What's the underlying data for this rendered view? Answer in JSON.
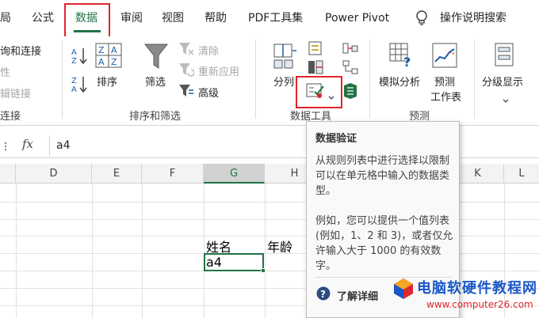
{
  "tabs": [
    "局",
    "公式",
    "数据",
    "审阅",
    "视图",
    "帮助",
    "PDF工具集",
    "Power Pivot",
    "操作说明搜索"
  ],
  "active_tab": "数据",
  "ribbon": {
    "query": {
      "item1": "询和连接",
      "item2": "性",
      "item3": "辑链接",
      "label": "连接"
    },
    "sort": {
      "sort_label": "排序",
      "filter_label": "筛选",
      "clear": "清除",
      "reapply": "重新应用",
      "advanced": "高级",
      "group_label": "排序和筛选"
    },
    "tools": {
      "split_label": "分列",
      "group_label": "数据工具"
    },
    "forecast": {
      "whatif": "模拟分析",
      "forecast_sheet_line1": "预测",
      "forecast_sheet_line2": "工作表",
      "group_label": "预测"
    },
    "outline": {
      "label": "分级显示"
    }
  },
  "formula_bar": {
    "fx": "fx",
    "value": "a4"
  },
  "columns": [
    "D",
    "E",
    "F",
    "G",
    "H",
    "K",
    "L"
  ],
  "cells": {
    "g_header": "姓名",
    "h_header": "年龄",
    "g_value": "a4"
  },
  "tooltip": {
    "title": "数据验证",
    "para1": "从规则列表中进行选择以限制可以在单元格中输入的数据类型。",
    "para2": "例如，您可以提供一个值列表(例如，1、2 和 3)，或者仅允许输入大于 1000 的有效数字。",
    "help": "了解详细"
  },
  "watermark": {
    "line1": "电脑软硬件教程网",
    "line2": "www.computer26.com"
  },
  "colors": {
    "accent": "#217346",
    "highlight": "#e0252c",
    "watermark_blue": "#1a56c7"
  }
}
